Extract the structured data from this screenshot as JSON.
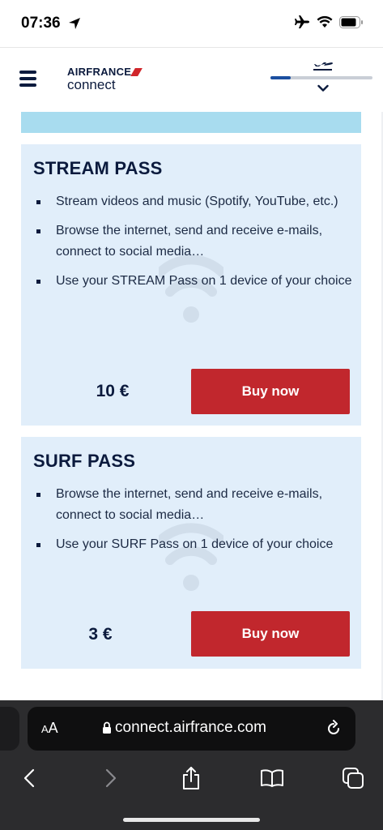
{
  "status_bar": {
    "time": "07:36"
  },
  "header": {
    "brand_top": "AIRFRANCE",
    "brand_bottom": "connect",
    "flight_progress": 0.2
  },
  "passes": [
    {
      "title": "STREAM PASS",
      "features": [
        "Stream videos and music (Spotify, YouTube, etc.)",
        "Browse the internet, send and receive e-mails, connect to social media…",
        "Use your STREAM Pass on 1 device of your choice"
      ],
      "price": "10 €",
      "button": "Buy now"
    },
    {
      "title": "SURF PASS",
      "features": [
        "Browse the internet, send and receive e-mails, connect to social media…",
        "Use your SURF Pass on 1 device of your choice"
      ],
      "price": "3 €",
      "button": "Buy now"
    }
  ],
  "browser": {
    "aa_label_big": "A",
    "aa_label_small": "A",
    "url": "connect.airfrance.com"
  },
  "colors": {
    "brand_navy": "#0b1a3d",
    "card_bg": "#e1eefa",
    "banner_bg": "#a8dcef",
    "buy_button": "#c1272d",
    "progress_fill": "#1b4fa0"
  },
  "icons": [
    "location-arrow-icon",
    "airplane-mode-icon",
    "wifi-icon",
    "battery-icon",
    "menu-icon",
    "plane-icon",
    "chevron-down-icon",
    "wifi-watermark-icon",
    "lock-icon",
    "reload-icon",
    "back-icon",
    "forward-icon",
    "share-icon",
    "bookmarks-icon",
    "tabs-icon"
  ]
}
